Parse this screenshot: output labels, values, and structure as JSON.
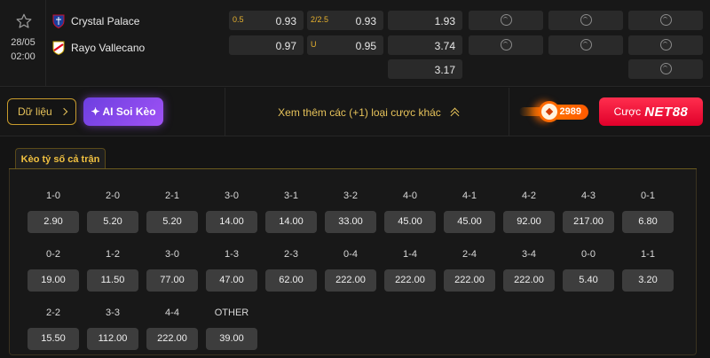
{
  "match": {
    "date": "28/05",
    "time": "02:00",
    "home": "Crystal Palace",
    "away": "Rayo Vallecano",
    "odds": {
      "row1": {
        "handicap_line": "0.5",
        "handicap_odd": "0.93",
        "total_line": "2/2.5",
        "total_odd": "0.93",
        "x12": "1.93"
      },
      "row2": {
        "handicap_odd": "0.97",
        "total_line": "U",
        "total_odd": "0.95",
        "x12": "3.74"
      },
      "row3": {
        "x12": "3.17"
      }
    }
  },
  "actions": {
    "data_label": "Dữ liệu",
    "ai_label": "AI Soi Kèo",
    "more_label": "Xem thêm các (+1) loại cược khác",
    "ball_count": "2989",
    "bet_prefix": "Cược",
    "bet_brand": "NET88"
  },
  "correct_score": {
    "tab_label": "Kèo tỷ số cả trận",
    "rows": [
      [
        {
          "score": "1-0",
          "odd": "2.90"
        },
        {
          "score": "2-0",
          "odd": "5.20"
        },
        {
          "score": "2-1",
          "odd": "5.20"
        },
        {
          "score": "3-0",
          "odd": "14.00"
        },
        {
          "score": "3-1",
          "odd": "14.00"
        },
        {
          "score": "3-2",
          "odd": "33.00"
        },
        {
          "score": "4-0",
          "odd": "45.00"
        },
        {
          "score": "4-1",
          "odd": "45.00"
        },
        {
          "score": "4-2",
          "odd": "92.00"
        },
        {
          "score": "4-3",
          "odd": "217.00"
        },
        {
          "score": "0-1",
          "odd": "6.80"
        }
      ],
      [
        {
          "score": "0-2",
          "odd": "19.00"
        },
        {
          "score": "1-2",
          "odd": "11.50"
        },
        {
          "score": "3-0",
          "odd": "77.00"
        },
        {
          "score": "1-3",
          "odd": "47.00"
        },
        {
          "score": "2-3",
          "odd": "62.00"
        },
        {
          "score": "0-4",
          "odd": "222.00"
        },
        {
          "score": "1-4",
          "odd": "222.00"
        },
        {
          "score": "2-4",
          "odd": "222.00"
        },
        {
          "score": "3-4",
          "odd": "222.00"
        },
        {
          "score": "0-0",
          "odd": "5.40"
        },
        {
          "score": "1-1",
          "odd": "3.20"
        }
      ],
      [
        {
          "score": "2-2",
          "odd": "15.50"
        },
        {
          "score": "3-3",
          "odd": "112.00"
        },
        {
          "score": "4-4",
          "odd": "222.00"
        },
        {
          "score": "OTHER",
          "odd": "39.00"
        }
      ]
    ]
  }
}
